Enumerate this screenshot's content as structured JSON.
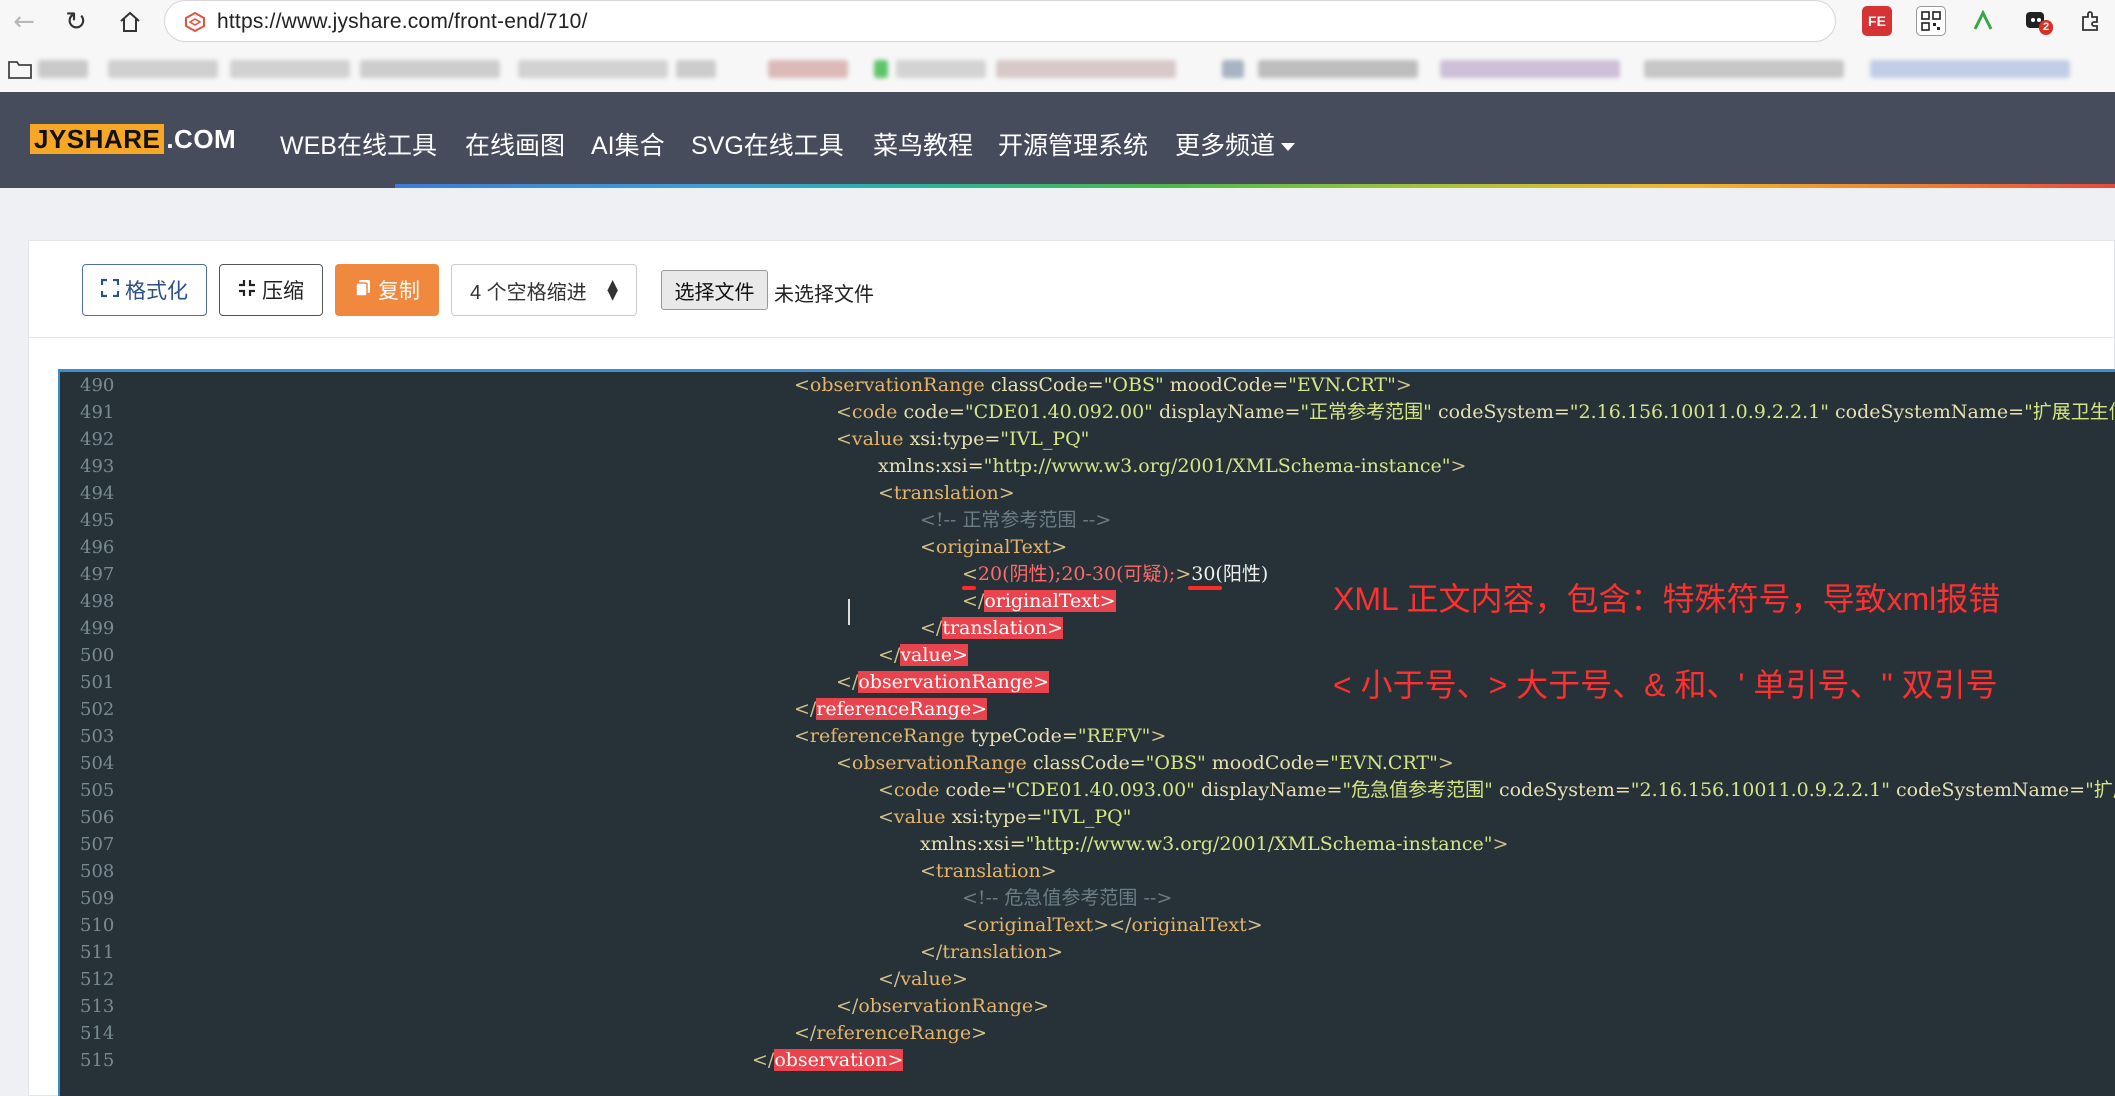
{
  "browser": {
    "url": "https://www.jyshare.com/front-end/710/",
    "ext_badge_count": "2"
  },
  "site": {
    "logo_box": "JYSHARE",
    "logo_rest": ".COM",
    "nav": [
      "WEB在线工具",
      "在线画图",
      "AI集合",
      "SVG在线工具",
      "菜鸟教程",
      "开源管理系统",
      "更多频道"
    ]
  },
  "toolbar": {
    "format_label": "格式化",
    "compress_label": "压缩",
    "copy_label": "复制",
    "indent_select_value": "4 个空格缩进",
    "file_button_label": "选择文件",
    "file_status": "未选择文件"
  },
  "editor": {
    "line_numbers": [
      "490",
      "491",
      "492",
      "493",
      "494",
      "495",
      "496",
      "497",
      "498",
      "499",
      "500",
      "501",
      "502",
      "503",
      "504",
      "505",
      "506",
      "507",
      "508",
      "509",
      "510",
      "511",
      "512",
      "513",
      "514",
      "515"
    ]
  },
  "annotations": {
    "line1": "XML 正文内容，包含：特殊符号，导致xml报错",
    "line2": "< 小于号、> 大于号、& 和、' 单引号、\" 双引号"
  },
  "colors": {
    "header_bg": "#474c5c",
    "editor_bg": "#263238",
    "copy_button": "#f0883e",
    "error_highlight": "#e9444d",
    "annotation_red": "#ff3030"
  }
}
